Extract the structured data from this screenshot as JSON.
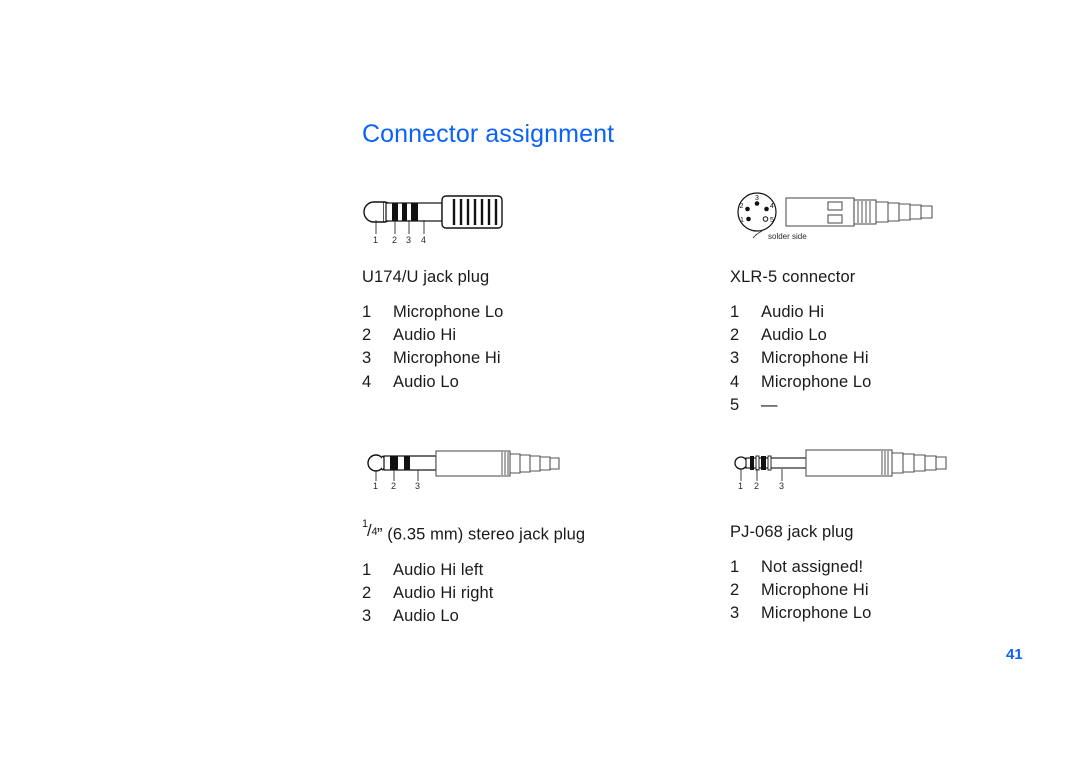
{
  "document": {
    "heading": "Connector assignment",
    "page_number": "41",
    "heading_color": "#0b63f6",
    "page_number_color": "#0b63f6",
    "background_color": "#ffffff",
    "text_color": "#1a1a1a"
  },
  "connectors": [
    {
      "id": "u174u",
      "caption": "U174/U jack plug",
      "figure_type": "nexus-4-contact-plug",
      "contact_numbers": [
        "1",
        "2",
        "3",
        "4"
      ],
      "pins": [
        {
          "number": "1",
          "label": "Microphone Lo"
        },
        {
          "number": "2",
          "label": "Audio Hi"
        },
        {
          "number": "3",
          "label": "Microphone Hi"
        },
        {
          "number": "4",
          "label": "Audio Lo"
        }
      ]
    },
    {
      "id": "xlr5",
      "caption": "XLR-5 connector",
      "figure_type": "xlr-5-connector",
      "figure_note": "solder side",
      "pin_positions": [
        {
          "number": "1",
          "filled": true
        },
        {
          "number": "2",
          "filled": true
        },
        {
          "number": "3",
          "filled": true
        },
        {
          "number": "4",
          "filled": true
        },
        {
          "number": "5",
          "filled": false
        }
      ],
      "pins": [
        {
          "number": "1",
          "label": "Audio Hi"
        },
        {
          "number": "2",
          "label": "Audio Lo"
        },
        {
          "number": "3",
          "label": "Microphone Hi"
        },
        {
          "number": "4",
          "label": "Microphone Lo"
        },
        {
          "number": "5",
          "label": "—"
        }
      ]
    },
    {
      "id": "stereo-jack",
      "caption_fraction": {
        "numerator": "1",
        "slash": "/",
        "denominator": "4"
      },
      "caption_rest": "” (6.35 mm) stereo jack plug",
      "caption_plain": "1/4” (6.35 mm) stereo jack plug",
      "figure_type": "stereo-jack-plug",
      "contact_numbers": [
        "1",
        "2",
        "3"
      ],
      "pins": [
        {
          "number": "1",
          "label": "Audio Hi left"
        },
        {
          "number": "2",
          "label": "Audio Hi right"
        },
        {
          "number": "3",
          "label": "Audio Lo"
        }
      ]
    },
    {
      "id": "pj068",
      "caption": "PJ-068 jack plug",
      "figure_type": "pj-068-jack-plug",
      "contact_numbers": [
        "1",
        "2",
        "3"
      ],
      "pins": [
        {
          "number": "1",
          "label": "Not assigned!"
        },
        {
          "number": "2",
          "label": "Microphone Hi"
        },
        {
          "number": "3",
          "label": "Microphone Lo"
        }
      ]
    }
  ]
}
